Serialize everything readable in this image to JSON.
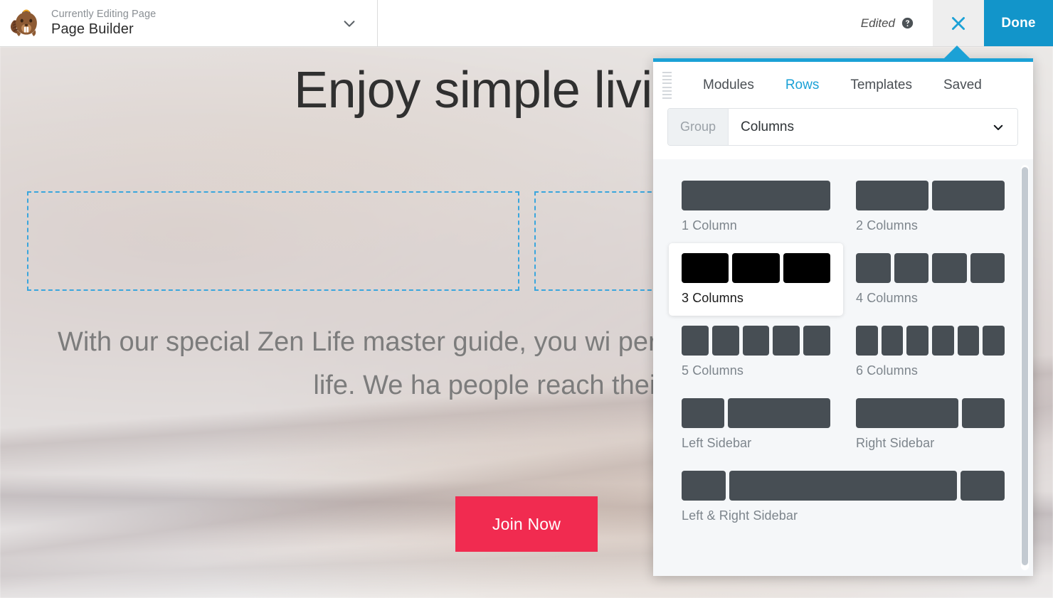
{
  "adminbar": {
    "logo_icon": "beaver-builder-logo",
    "eyebrow": "Currently Editing Page",
    "title": "Page Builder",
    "chevron_icon": "chevron-down-icon",
    "edited_label": "Edited",
    "help_icon": "help-circle-icon",
    "close_icon": "close-x-icon",
    "done_label": "Done",
    "accent_color": "#1295ca",
    "close_bg": "#eeeeee"
  },
  "page": {
    "heading": "Enjoy simple living w",
    "paragraph": "With our special Zen Life master guide, you wi person living a simple and easy life. We ha people reach their poten",
    "cta_label": "Join Now",
    "cta_color": "#f12b50",
    "placeholder_outline_color": "#3aa6dd",
    "placeholder_count": 2
  },
  "panel": {
    "pointer_color": "#1ba1d6",
    "border_top_color": "#1ba1d6",
    "grip_icon": "drag-grip-icon",
    "tabs": [
      {
        "label": "Modules",
        "active": false
      },
      {
        "label": "Rows",
        "active": true
      },
      {
        "label": "Templates",
        "active": false
      },
      {
        "label": "Saved",
        "active": false
      }
    ],
    "group": {
      "label": "Group",
      "value": "Columns",
      "chevron_icon": "chevron-down-icon"
    },
    "rows": [
      {
        "label": "1 Column",
        "weights": [
          1
        ],
        "full": false,
        "hovered": false
      },
      {
        "label": "2 Columns",
        "weights": [
          1,
          1
        ],
        "full": false,
        "hovered": false
      },
      {
        "label": "3 Columns",
        "weights": [
          1,
          1,
          1
        ],
        "full": false,
        "hovered": true
      },
      {
        "label": "4 Columns",
        "weights": [
          1,
          1,
          1,
          1
        ],
        "full": false,
        "hovered": false
      },
      {
        "label": "5 Columns",
        "weights": [
          1,
          1,
          1,
          1,
          1
        ],
        "full": false,
        "hovered": false
      },
      {
        "label": "6 Columns",
        "weights": [
          1,
          1,
          1,
          1,
          1,
          1
        ],
        "full": false,
        "hovered": false
      },
      {
        "label": "Left Sidebar",
        "weights": [
          1,
          2.4
        ],
        "full": false,
        "hovered": false
      },
      {
        "label": "Right Sidebar",
        "weights": [
          2.4,
          1
        ],
        "full": false,
        "hovered": false
      },
      {
        "label": "Left & Right Sidebar",
        "weights": [
          1,
          5.2,
          1
        ],
        "full": true,
        "hovered": false
      }
    ],
    "scrollbar": {
      "thumb_color": "#c3cad1"
    }
  }
}
